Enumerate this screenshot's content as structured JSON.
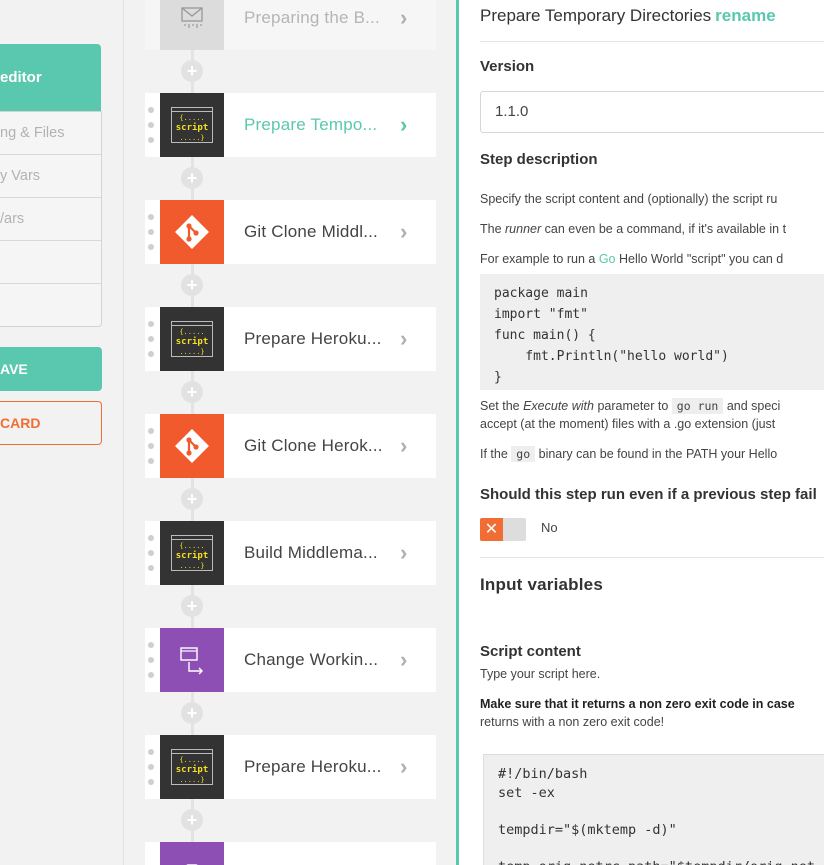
{
  "left_nav": {
    "active_item": "editor",
    "items": [
      "ng & Files",
      "y Vars",
      "/ars",
      "",
      ""
    ],
    "save_label": "AVE",
    "discard_label": "CARD"
  },
  "workflow": {
    "steps": [
      {
        "name": "Preparing the B...",
        "icon": "cache-icon",
        "state": "disabled"
      },
      {
        "name": "Prepare Tempo...",
        "icon": "script-icon",
        "state": "active"
      },
      {
        "name": "Git Clone Middl...",
        "icon": "git-icon",
        "state": "normal"
      },
      {
        "name": "Prepare Heroku...",
        "icon": "script-icon",
        "state": "normal"
      },
      {
        "name": "Git Clone Herok...",
        "icon": "git-icon",
        "state": "normal"
      },
      {
        "name": "Build Middlema...",
        "icon": "script-icon",
        "state": "normal"
      },
      {
        "name": "Change Workin...",
        "icon": "change-dir-icon",
        "state": "normal"
      },
      {
        "name": "Prepare Heroku...",
        "icon": "script-icon",
        "state": "normal"
      }
    ],
    "script_icon_text": {
      "top": "{.....",
      "mid": "script",
      "bottom": ".....}"
    },
    "add_symbol": "+",
    "chevron": "›"
  },
  "details": {
    "title": "Prepare Temporary Directories",
    "rename_label": "rename",
    "version_label": "Version",
    "version_value": "1.1.0",
    "step_description_label": "Step description",
    "desc_line1": "Specify the script content and (optionally) the script ru",
    "desc_line2_pre": "The ",
    "desc_line2_em": "runner",
    "desc_line2_post": " can even be a command, if it's available in t",
    "desc_line3_pre": "For example to run a ",
    "desc_line3_link": "Go",
    "desc_line3_post": " Hello World \"script\" you can d",
    "code_example": "package main\nimport \"fmt\"\nfunc main() {\n    fmt.Println(\"hello world\")\n}",
    "desc_line4_pre": "Set the ",
    "desc_line4_em": "Execute with",
    "desc_line4_mid": " parameter to ",
    "desc_line4_code": "go run",
    "desc_line4_post": " and speci",
    "desc_line5": "accept (at the moment) files with a .go extension (just",
    "desc_line6_pre": "If the ",
    "desc_line6_code": "go",
    "desc_line6_post": " binary can be found in the PATH your Hello",
    "run_if_failed_label": "Should this step run even if a previous step fail",
    "toggle_symbol": "✕",
    "toggle_value": "No",
    "input_variables_label": "Input variables",
    "script_content_label": "Script content",
    "script_hint": "Type your script here.",
    "script_warning_bold": "Make sure that it returns a non zero exit code in case",
    "script_warning_rest": "returns with a non zero exit code!",
    "script_value": "#!/bin/bash\nset -ex\n\ntempdir=\"$(mktemp -d)\"\n\ntemp_orig_netrc_path=\"$tempdir/orig_net"
  },
  "colors": {
    "accent": "#5ac8ae",
    "orange": "#f16d34",
    "git": "#f15a2c",
    "purple": "#8e4fb4",
    "dark": "#333333"
  }
}
